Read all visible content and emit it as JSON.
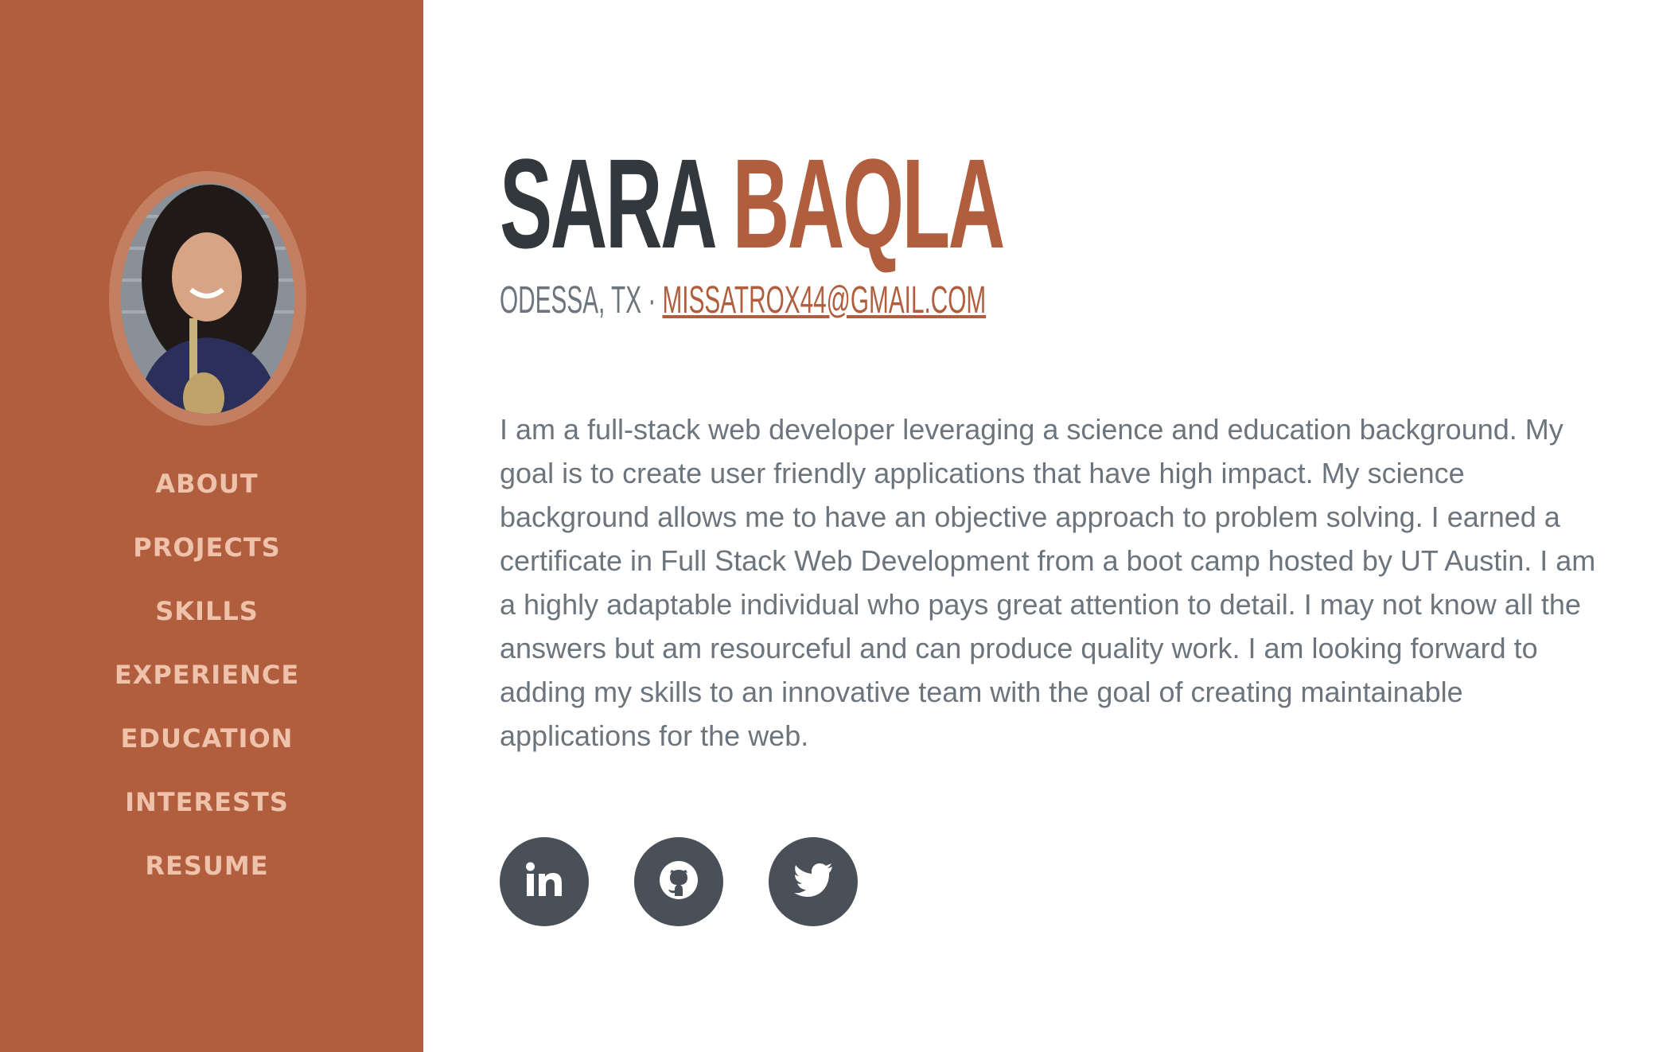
{
  "profile": {
    "first_name": "SARA",
    "last_name": "BAQLA",
    "location": "ODESSA, TX",
    "separator": " · ",
    "email": "MISSATROX44@GMAIL.COM",
    "photo_alt": "Sara Baqla"
  },
  "nav": {
    "items": [
      {
        "label": "ABOUT"
      },
      {
        "label": "PROJECTS"
      },
      {
        "label": "SKILLS"
      },
      {
        "label": "EXPERIENCE"
      },
      {
        "label": "EDUCATION"
      },
      {
        "label": "INTERESTS"
      },
      {
        "label": "RESUME"
      }
    ]
  },
  "about": {
    "bio": "I am a full-stack web developer leveraging a science and education background. My goal is to create user friendly applications that have high impact. My science background allows me to have an objective approach to problem solving. I earned a certificate in Full Stack Web Development from a boot camp hosted by UT Austin. I am a highly adaptable individual who pays great attention to detail. I may not know all the answers but am resourceful and can produce quality work. I am looking forward to adding my skills to an innovative team with the goal of creating maintainable applications for the web."
  },
  "social": [
    {
      "icon": "linkedin-icon"
    },
    {
      "icon": "github-icon"
    },
    {
      "icon": "twitter-icon"
    }
  ],
  "colors": {
    "accent": "#b05e3e",
    "sidebar_bg": "#b05e3e",
    "nav_text": "#eec2ab",
    "heading_dark": "#33383d",
    "body_text": "#6c757d",
    "social_bg": "#495057",
    "background": "#ffffff"
  }
}
